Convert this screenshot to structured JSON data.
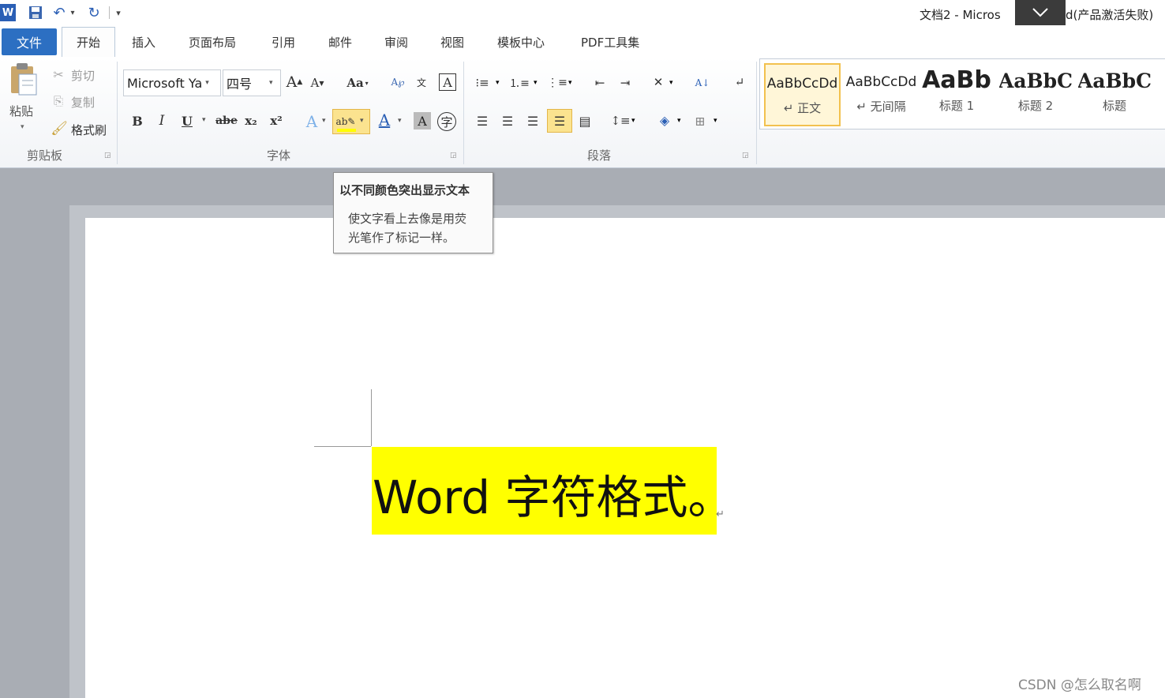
{
  "titlebar": {
    "title_left": "文档2 - Micros",
    "title_right": "d(产品激活失败)",
    "overlay_icon": "chevron-down-icon",
    "quick_access": [
      "word-logo-icon",
      "save-icon",
      "undo-icon",
      "redo-icon",
      "customize-icon"
    ]
  },
  "tabs": {
    "file": "文件",
    "home": "开始",
    "insert": "插入",
    "layout": "页面布局",
    "references": "引用",
    "mailings": "邮件",
    "review": "审阅",
    "view": "视图",
    "templates": "模板中心",
    "pdf": "PDF工具集"
  },
  "clipboard": {
    "paste": "粘贴",
    "cut": "剪切",
    "copy": "复制",
    "format_painter": "格式刷",
    "label": "剪贴板"
  },
  "font": {
    "name": "Microsoft Ya",
    "size": "四号",
    "label": "字体",
    "bold": "B",
    "italic": "I",
    "underline": "U",
    "strike": "abe",
    "subscript": "x₂",
    "superscript": "x²",
    "grow": "A",
    "shrink": "A",
    "change_case": "Aa"
  },
  "paragraph": {
    "label": "段落"
  },
  "styles": [
    {
      "preview": "AaBbCcDd",
      "name": "↵ 正文"
    },
    {
      "preview": "AaBbCcDd",
      "name": "↵ 无间隔"
    },
    {
      "preview": "AaBb",
      "name": "标题 1"
    },
    {
      "preview": "AaBbC",
      "name": "标题 2"
    },
    {
      "preview": "AaBbC",
      "name": "标题"
    }
  ],
  "tooltip": {
    "title": "以不同颜色突出显示文本",
    "line1": "使文字看上去像是用荧",
    "line2": "光笔作了标记一样。"
  },
  "document": {
    "text": "Word 字符格式。",
    "paragraph_mark": "↵",
    "highlight_color": "#ffff00"
  },
  "watermark": "CSDN @怎么取名啊",
  "colors": {
    "file_tab": "#2c6fc2",
    "selected_style_border": "#f2c14e",
    "highlight_button": "#fbe38f"
  }
}
